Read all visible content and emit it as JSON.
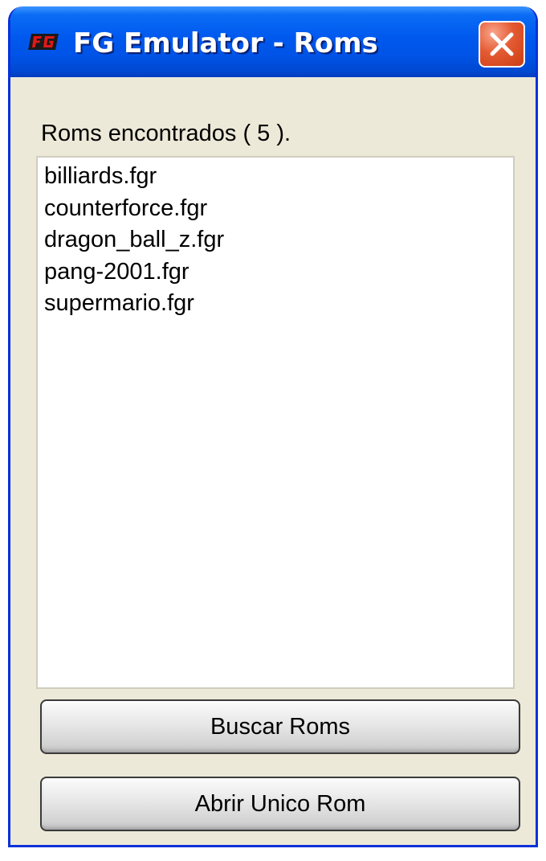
{
  "window": {
    "title": "FG Emulator - Roms",
    "icon": "fg-emulator-logo-icon",
    "close_icon": "close-icon"
  },
  "roms": {
    "found_label": "Roms encontrados ( 5 ).",
    "items": [
      {
        "label": "billiards.fgr"
      },
      {
        "label": "counterforce.fgr"
      },
      {
        "label": "dragon_ball_z.fgr"
      },
      {
        "label": "pang-2001.fgr"
      },
      {
        "label": "supermario.fgr"
      }
    ]
  },
  "buttons": {
    "search_label": "Buscar Roms",
    "open_single_label": "Abrir Unico Rom"
  },
  "colors": {
    "titlebar": "#0058ee",
    "window_bg": "#ece9d8",
    "close_button": "#e45a32"
  }
}
